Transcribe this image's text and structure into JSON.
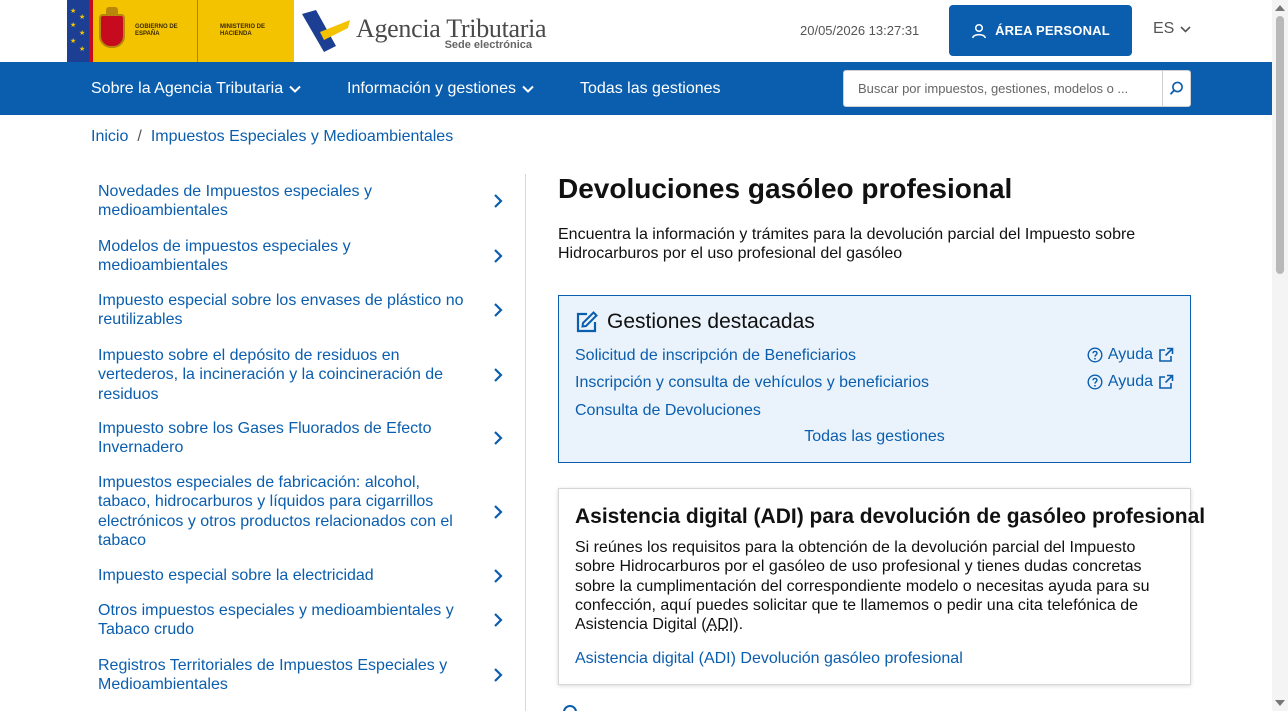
{
  "header": {
    "gov_line1": "Gobierno de España",
    "gov_line2": "Ministerio de Hacienda",
    "site_title": "Agencia Tributaria",
    "site_subtitle": "Sede electrónica",
    "datetime": "20/05/2026 13:27:31",
    "personal_area_label": "ÁREA PERSONAL",
    "language": "ES"
  },
  "nav": {
    "items": [
      {
        "label": "Sobre la Agencia Tributaria",
        "has_dropdown": true
      },
      {
        "label": "Información y gestiones",
        "has_dropdown": true
      },
      {
        "label": "Todas las gestiones",
        "has_dropdown": false
      }
    ],
    "search_placeholder": "Buscar por impuestos, gestiones, modelos o ..."
  },
  "breadcrumb": {
    "items": [
      "Inicio",
      "Impuestos Especiales y Medioambientales"
    ],
    "separator": "/"
  },
  "sidebar": {
    "items": [
      {
        "label": "Novedades de Impuestos especiales y medioambientales"
      },
      {
        "label": "Modelos de impuestos especiales y medioambientales"
      },
      {
        "label": "Impuesto especial sobre los envases de plástico no reutilizables"
      },
      {
        "label": "Impuesto sobre el depósito de residuos en vertederos, la incineración y la coincineración de residuos"
      },
      {
        "label": "Impuesto sobre los Gases Fluorados de Efecto Invernadero"
      },
      {
        "label": "Impuestos especiales de fabricación: alcohol, tabaco, hidrocarburos y líquidos para cigarrillos electrónicos y otros productos relacionados con el tabaco"
      },
      {
        "label": "Impuesto especial sobre la electricidad"
      },
      {
        "label": "Otros impuestos especiales y medioambientales y Tabaco crudo"
      },
      {
        "label": "Registros Territoriales de Impuestos Especiales y Medioambientales"
      }
    ]
  },
  "main": {
    "title": "Devoluciones gasóleo profesional",
    "intro": "Encuentra la información y trámites para la devolución parcial del Impuesto sobre Hidrocarburos por el uso profesional del gasóleo",
    "featured": {
      "heading": "Gestiones destacadas",
      "links": [
        {
          "label": "Solicitud de inscripción de Beneficiarios",
          "help": "Ayuda"
        },
        {
          "label": "Inscripción y consulta de vehículos y beneficiarios",
          "help": "Ayuda"
        },
        {
          "label": "Consulta de Devoluciones"
        }
      ],
      "all_label": "Todas las gestiones"
    },
    "adi": {
      "title": "Asistencia digital (ADI) para devolución de gasóleo profesional",
      "text_before": "Si reúnes los requisitos para la obtención de la devolución parcial del Impuesto sobre Hidrocarburos por el gasóleo de uso profesional y tienes dudas concretas sobre la cumplimentación del correspondiente modelo o necesitas ayuda para su confección, aquí puedes solicitar que te llamemos o pedir una cita telefónica de Asistencia Digital (",
      "abbr": "ADI",
      "text_after": ").",
      "link": "Asistencia digital (ADI) Devolución gasóleo profesional"
    }
  },
  "colors": {
    "brand_blue": "#0b5eae",
    "gov_yellow": "#f3c300",
    "eu_blue": "#1c3f94",
    "featured_bg": "#eaf3fb"
  }
}
